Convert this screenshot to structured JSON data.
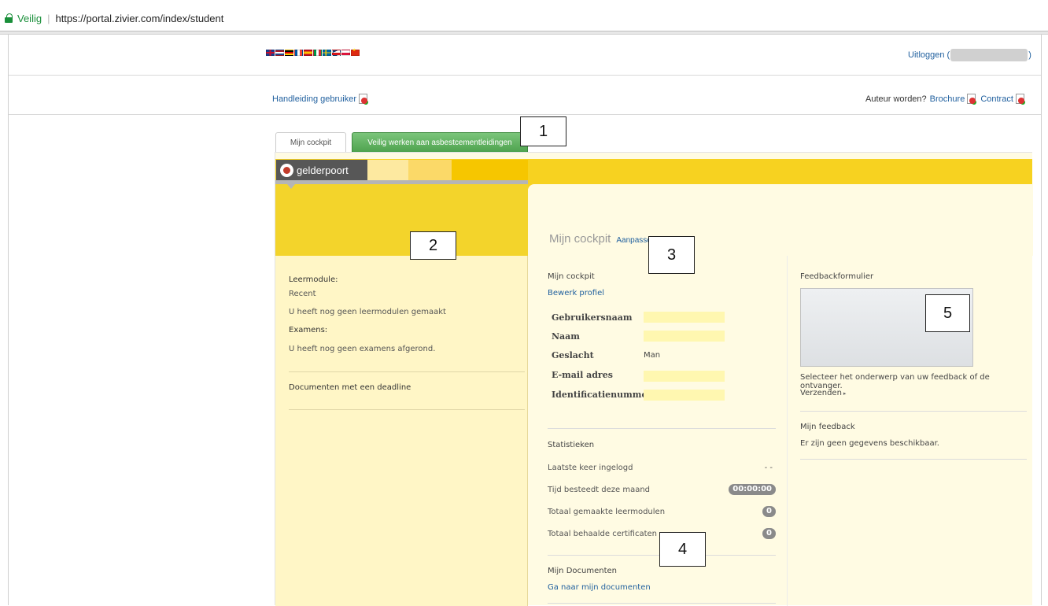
{
  "browser": {
    "secure_label": "Veilig",
    "url": "https://portal.zivier.com/index/student"
  },
  "header": {
    "logout_label": "Uitloggen (",
    "logout_close": ")",
    "manual_link": "Handleiding gebruiker",
    "author_question": "Auteur worden?",
    "brochure_link": "Brochure",
    "contract_link": "Contract",
    "flags": [
      "flag-uk-icon",
      "flag-nl-icon",
      "flag-de-icon",
      "flag-fr-icon",
      "flag-es-icon",
      "flag-it-icon",
      "flag-se-icon",
      "flag-cz-icon",
      "flag-pl-icon",
      "flag-cn-icon"
    ]
  },
  "tabs": [
    {
      "label": "Mijn cockpit"
    },
    {
      "label": "Veilig werken aan asbestcementleidingen"
    }
  ],
  "callouts": [
    "1",
    "2",
    "3",
    "4",
    "5"
  ],
  "brand": {
    "logo_text": "gelderpoort",
    "colors": {
      "yellow": "#f7d220",
      "panel": "#fffbe3",
      "left": "#fff6c6",
      "link": "#1f5f9e",
      "tab_green": "#4fa34f"
    }
  },
  "main": {
    "title": "Mijn cockpit",
    "edit_link": "Aanpassen"
  },
  "left": {
    "module_heading": "Leermodule:",
    "recent": "Recent",
    "no_modules": "U heeft nog geen leermodulen gemaakt",
    "exams_heading": "Examens:",
    "no_exams": "U heeft nog geen examens afgerond.",
    "deadline_docs": "Documenten met een deadline"
  },
  "profile": {
    "heading": "Mijn cockpit",
    "edit_link": "Bewerk profiel",
    "fields": [
      {
        "label": "Gebruikersnaam",
        "value": ""
      },
      {
        "label": "Naam",
        "value": ""
      },
      {
        "label": "Geslacht",
        "value": "Man"
      },
      {
        "label": "E-mail adres",
        "value": ""
      },
      {
        "label": "Identificatienummer",
        "value": ""
      }
    ]
  },
  "stats": {
    "heading": "Statistieken",
    "rows": [
      {
        "label": "Laatste keer ingelogd",
        "value": "- -"
      },
      {
        "label": "Tijd besteedt deze maand",
        "value": "00:00:00"
      },
      {
        "label": "Totaal gemaakte leermodulen",
        "value": "0"
      },
      {
        "label": "Totaal behaalde certificaten",
        "value": "0"
      }
    ]
  },
  "documents": {
    "heading": "Mijn Documenten",
    "link": "Ga naar mijn documenten"
  },
  "feedback": {
    "heading": "Feedbackformulier",
    "hint": "Selecteer het onderwerp van uw feedback of de ontvanger.",
    "send": "Verzenden",
    "my_heading": "Mijn feedback",
    "empty": "Er zijn geen gegevens beschikbaar."
  }
}
